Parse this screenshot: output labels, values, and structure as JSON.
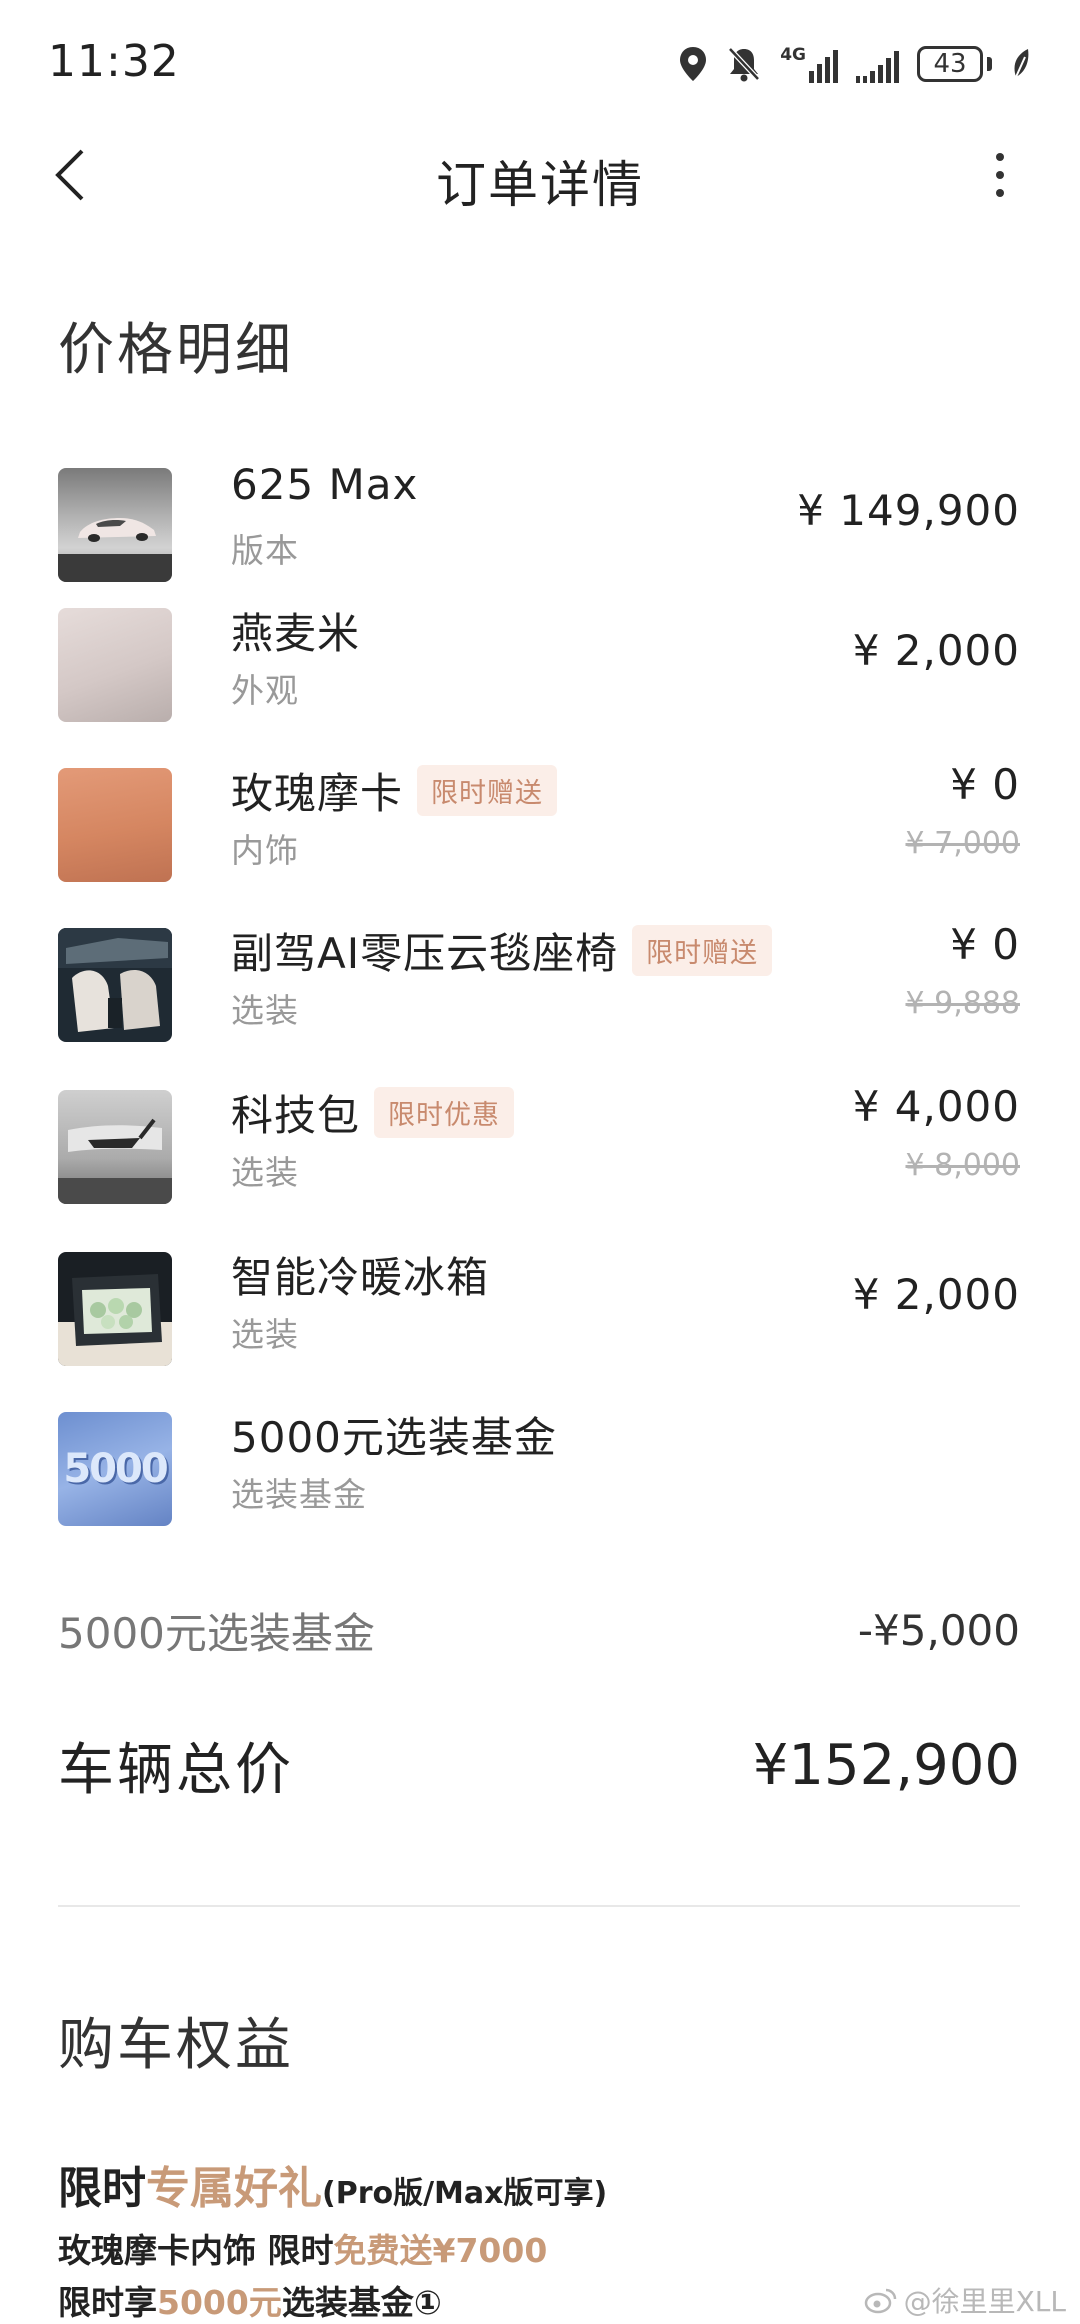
{
  "status_bar": {
    "time": "11:32",
    "network_label": "4G",
    "battery_level": "43"
  },
  "nav": {
    "title": "订单详情"
  },
  "price_section": {
    "title": "价格明细",
    "items": [
      {
        "name": "625 Max",
        "sub": "版本",
        "price": "¥ 149,900",
        "tag": "",
        "original_price": ""
      },
      {
        "name": "燕麦米",
        "sub": "外观",
        "price": "¥ 2,000",
        "tag": "",
        "original_price": ""
      },
      {
        "name": "玫瑰摩卡",
        "sub": "内饰",
        "price": "¥ 0",
        "tag": "限时赠送",
        "original_price": "¥ 7,000"
      },
      {
        "name": "副驾AI零压云毯座椅",
        "sub": "选装",
        "price": "¥ 0",
        "tag": "限时赠送",
        "original_price": "¥ 9,888"
      },
      {
        "name": "科技包",
        "sub": "选装",
        "price": "¥ 4,000",
        "tag": "限时优惠",
        "original_price": "¥ 8,000"
      },
      {
        "name": "智能冷暖冰箱",
        "sub": "选装",
        "price": "¥ 2,000",
        "tag": "",
        "original_price": ""
      },
      {
        "name": "5000元选装基金",
        "sub": "选装基金",
        "price": "",
        "tag": "",
        "original_price": "",
        "thumb_text": "5000"
      }
    ],
    "fund_row": {
      "label": "5000元选装基金",
      "value": "-¥5,000"
    },
    "total_row": {
      "label": "车辆总价",
      "value": "¥152,900"
    }
  },
  "benefits_section": {
    "title": "购车权益",
    "line1": {
      "part1": "限时",
      "accent": "专属好礼",
      "small": "(Pro版/Max版可享)"
    },
    "line2": {
      "part1": "玫瑰摩卡内饰 限时",
      "accent": "免费送¥7000"
    },
    "line3": {
      "part1": "限时享",
      "accent": "5000元",
      "part2": "选装基金①"
    }
  },
  "watermark": {
    "text": "@徐里里XLL"
  },
  "colors": {
    "accent": "#c89a78",
    "tag_bg": "#fbeee8",
    "tag_text": "#c88a6e",
    "secondary_text": "#999999"
  }
}
